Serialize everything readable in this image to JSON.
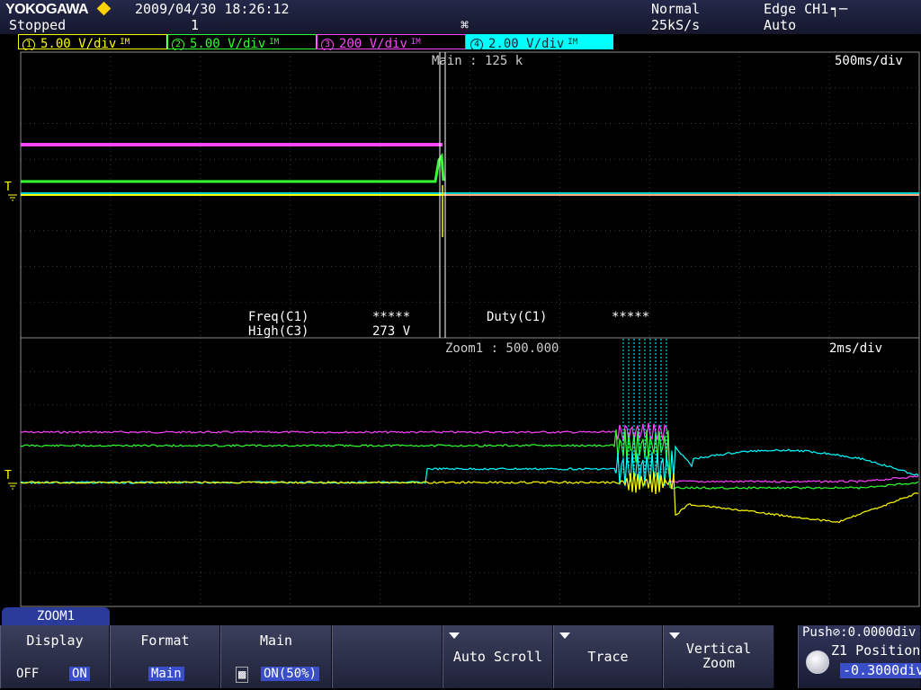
{
  "header": {
    "brand": "YOKOGAWA",
    "datetime": "2009/04/30 18:26:12",
    "state": "Stopped",
    "acq_count": "1",
    "mode": "Normal",
    "sample_rate": "25kS/s",
    "trigger_type": "Edge CH1",
    "trigger_mode": "Auto"
  },
  "channels": [
    {
      "num": "1",
      "scale": "5.00 V",
      "unit": "/div",
      "tag": "IM",
      "color": "#ffff00"
    },
    {
      "num": "2",
      "scale": "5.00 V",
      "unit": "/div",
      "tag": "IM",
      "color": "#33ff33"
    },
    {
      "num": "3",
      "scale": "200 V",
      "unit": "/div",
      "tag": "IM",
      "color": "#ff44ff"
    },
    {
      "num": "4",
      "scale": "2.00 V",
      "unit": "/div",
      "tag": "IM",
      "color": "#00ffff"
    }
  ],
  "main_window": {
    "label": "Main : 125 k",
    "timebase": "500ms/div",
    "trigger_marker": "T"
  },
  "measurements": {
    "row1_name1": "Freq(C1)",
    "row1_value1": "*****",
    "row1_name2": "Duty(C1)",
    "row1_value2": "*****",
    "row2_name1": "High(C3)",
    "row2_value1": "273 V"
  },
  "zoom_window": {
    "label": "Zoom1 : 500.000",
    "timebase": "2ms/div",
    "trigger_marker": "T"
  },
  "menu": {
    "tab": "ZOOM1",
    "display_label": "Display",
    "display_off": "OFF",
    "display_on": "ON",
    "format_label": "Format",
    "format_value": "Main",
    "main_label": "Main",
    "main_value": "ON(50%)",
    "auto_scroll_label": "Auto Scroll",
    "trace_label": "Trace",
    "vertical_zoom_label1": "Vertical",
    "vertical_zoom_label2": "Zoom",
    "push_hint": "Push",
    "push_value": ":0.0000div",
    "position_label": "Z1 Position",
    "position_value": "-0.3000div"
  },
  "colors": {
    "ch1": "#ffff00",
    "ch2": "#33ff33",
    "ch3": "#ff44ff",
    "ch4": "#00ffff",
    "grid": "#3a3a3a",
    "tab_blue": "#2a3b9c",
    "header_bg": "#1c1f3a"
  }
}
